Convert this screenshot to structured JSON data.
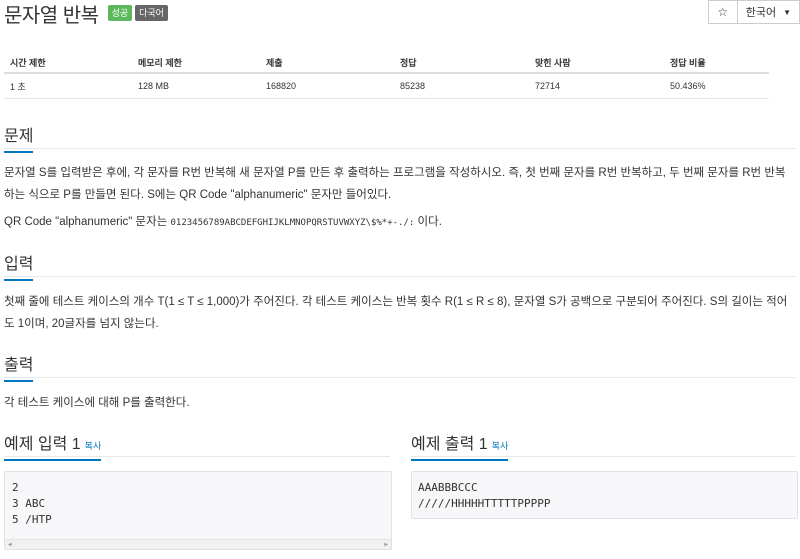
{
  "title": "문자열 반복",
  "badges": {
    "success": "성공",
    "multilang": "다국어"
  },
  "lang_button": {
    "label": "한국어"
  },
  "info": {
    "headers": [
      "시간 제한",
      "메모리 제한",
      "제출",
      "정답",
      "맞힌 사람",
      "정답 비율"
    ],
    "values": [
      "1 초",
      "128 MB",
      "168820",
      "85238",
      "72714",
      "50.436%"
    ]
  },
  "problem": {
    "heading": "문제",
    "text": "문자열 S를 입력받은 후에, 각 문자를 R번 반복해 새 문자열 P를 만든 후 출력하는 프로그램을 작성하시오. 즉, 첫 번째 문자를 R번 반복하고, 두 번째 문자를 R번 반복하는 식으로 P를 만들면 된다. S에는 QR Code \"alphanumeric\" 문자만 들어있다.",
    "qr_prefix": "QR Code \"alphanumeric\" 문자는",
    "qr_chars": "0123456789ABCDEFGHIJKLMNOPQRSTUVWXYZ\\$%*+-./:",
    "qr_suffix": "이다."
  },
  "input": {
    "heading": "입력",
    "text": "첫째 줄에 테스트 케이스의 개수 T(1 ≤ T ≤ 1,000)가 주어진다. 각 테스트 케이스는 반복 횟수 R(1 ≤ R ≤ 8), 문자열 S가 공백으로 구분되어 주어진다. S의 길이는 적어도 1이며, 20글자를 넘지 않는다."
  },
  "output": {
    "heading": "출력",
    "text": "각 테스트 케이스에 대해 P를 출력한다."
  },
  "sample_input": {
    "heading": "예제 입력 1",
    "copy": "복사",
    "lines": [
      "2",
      "3 ABC",
      "5 /HTP"
    ]
  },
  "sample_output": {
    "heading": "예제 출력 1",
    "copy": "복사",
    "lines": [
      "AAABBBCCC",
      "/////HHHHHTTTTTPPPPP"
    ]
  },
  "icons": {
    "star": "star-icon",
    "caret": "caret-down-icon",
    "scroll_left": "scroll-left-arrow-icon",
    "scroll_right": "scroll-right-arrow-icon"
  },
  "colors": {
    "accent": "#0076c0",
    "success": "#5cb85c",
    "multilang": "#666666"
  }
}
